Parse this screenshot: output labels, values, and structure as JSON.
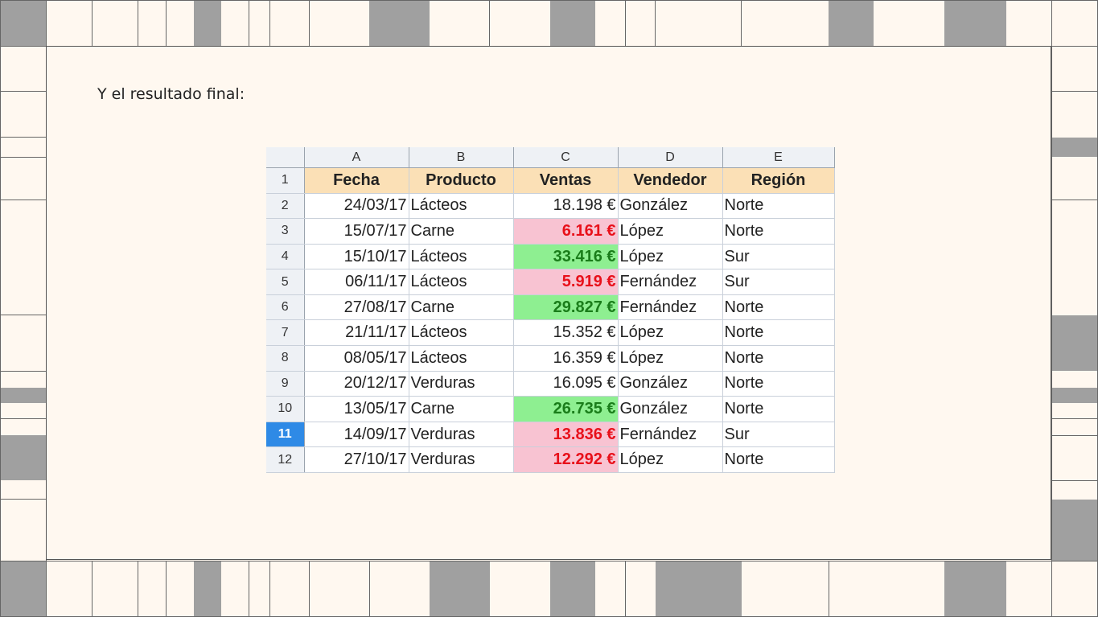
{
  "caption": "Y el resultado final:",
  "colors": {
    "background": "#fff8f0",
    "grid_fill": "#a0a0a0",
    "header_fill": "#fbe0b6",
    "low_fill": "#f8c3d2",
    "low_text": "#e8101a",
    "high_fill": "#8eef91",
    "high_text": "#1a7d1a",
    "active_row": "#2e8ae6"
  },
  "spreadsheet": {
    "column_letters": [
      "A",
      "B",
      "C",
      "D",
      "E"
    ],
    "active_row": "11",
    "header_row": {
      "number": "1",
      "cells": [
        "Fecha",
        "Producto",
        "Ventas",
        "Vendedor",
        "Región"
      ]
    },
    "rows": [
      {
        "n": "2",
        "fecha": "24/03/17",
        "producto": "Lácteos",
        "ventas": "18.198 €",
        "vendedor": "González",
        "region": "Norte",
        "status": "normal"
      },
      {
        "n": "3",
        "fecha": "15/07/17",
        "producto": "Carne",
        "ventas": "6.161 €",
        "vendedor": "López",
        "region": "Norte",
        "status": "low"
      },
      {
        "n": "4",
        "fecha": "15/10/17",
        "producto": "Lácteos",
        "ventas": "33.416 €",
        "vendedor": "López",
        "region": "Sur",
        "status": "high"
      },
      {
        "n": "5",
        "fecha": "06/11/17",
        "producto": "Lácteos",
        "ventas": "5.919 €",
        "vendedor": "Fernández",
        "region": "Sur",
        "status": "low"
      },
      {
        "n": "6",
        "fecha": "27/08/17",
        "producto": "Carne",
        "ventas": "29.827 €",
        "vendedor": "Fernández",
        "region": "Norte",
        "status": "high"
      },
      {
        "n": "7",
        "fecha": "21/11/17",
        "producto": "Lácteos",
        "ventas": "15.352 €",
        "vendedor": "López",
        "region": "Norte",
        "status": "normal"
      },
      {
        "n": "8",
        "fecha": "08/05/17",
        "producto": "Lácteos",
        "ventas": "16.359 €",
        "vendedor": "López",
        "region": "Norte",
        "status": "normal"
      },
      {
        "n": "9",
        "fecha": "20/12/17",
        "producto": "Verduras",
        "ventas": "16.095 €",
        "vendedor": "González",
        "region": "Norte",
        "status": "normal"
      },
      {
        "n": "10",
        "fecha": "13/05/17",
        "producto": "Carne",
        "ventas": "26.735 €",
        "vendedor": "González",
        "region": "Norte",
        "status": "high"
      },
      {
        "n": "11",
        "fecha": "14/09/17",
        "producto": "Verduras",
        "ventas": "13.836 €",
        "vendedor": "Fernández",
        "region": "Sur",
        "status": "low"
      },
      {
        "n": "12",
        "fecha": "27/10/17",
        "producto": "Verduras",
        "ventas": "12.292 €",
        "vendedor": "López",
        "region": "Norte",
        "status": "low"
      }
    ]
  }
}
